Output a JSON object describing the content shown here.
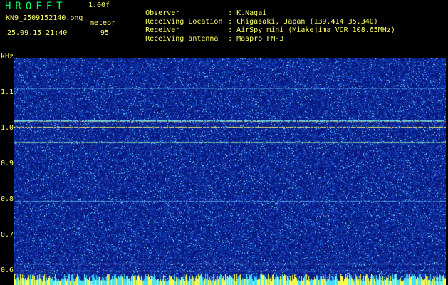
{
  "header": {
    "app_title": "HROFFT",
    "version": "1.00f",
    "filename": "KN9_2509152140.png",
    "datetime": "25.09.15 21:40",
    "meteor_label": "meteor",
    "meteor_count": "95"
  },
  "info": [
    {
      "key": "Observer",
      "value": "K.Nagai"
    },
    {
      "key": "Receiving Location",
      "value": "Chigasaki, Japan (139.414 35.340)"
    },
    {
      "key": "Receiver",
      "value": "AirSpy mini (Miakejima VOR 108.65MHz)"
    },
    {
      "key": "Receiving antenna",
      "value": "Maspro FM-3"
    }
  ],
  "axes": {
    "y_unit": "kHz",
    "y_ticks": [
      "1.1",
      "1.0",
      "0.9",
      "0.8",
      "0.7",
      "0.6"
    ],
    "x_ticks": [
      "2141",
      "2142",
      "2143",
      "2144",
      "2145",
      "2146",
      "2147",
      "2148",
      "2149",
      "2150"
    ]
  },
  "colors": {
    "background": "#000000",
    "spectrogram_base": "#0a1e8c",
    "label_yellow": "#ffff66",
    "title_green": "#00ff66",
    "signal_cyan": "#66ffff"
  }
}
